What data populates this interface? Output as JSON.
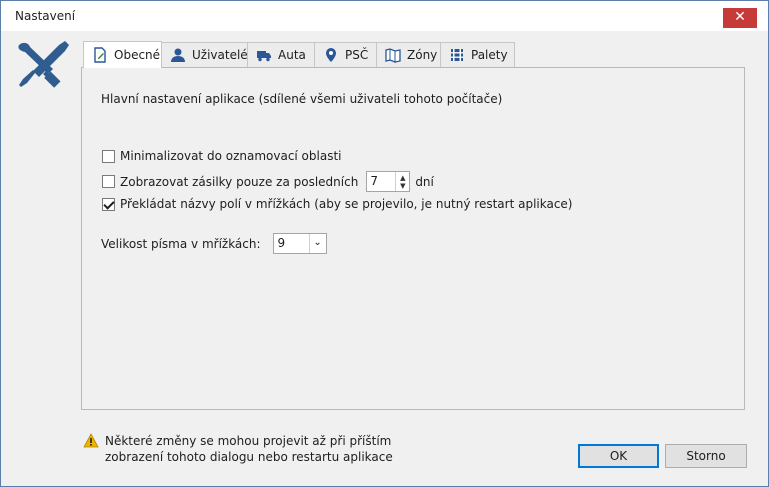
{
  "window": {
    "title": "Nastavení",
    "close_label": "✕"
  },
  "tabs": [
    {
      "label": "Obecné",
      "icon": "page-edit-icon",
      "active": true
    },
    {
      "label": "Uživatelé",
      "icon": "user-icon"
    },
    {
      "label": "Auta",
      "icon": "truck-icon"
    },
    {
      "label": "PSČ",
      "icon": "map-pin-icon"
    },
    {
      "label": "Zóny",
      "icon": "map-icon"
    },
    {
      "label": "Palety",
      "icon": "pallet-icon"
    }
  ],
  "general": {
    "description": "Hlavní nastavení aplikace (sdílené všemi uživateli tohoto počítače)",
    "options": [
      {
        "label": "Minimalizovat do oznamovací oblasti",
        "checked": false
      },
      {
        "label": "Zobrazovat zásilky pouze za posledních",
        "checked": false,
        "spin_value": "7",
        "suffix": "dní"
      },
      {
        "label": "Překládat názvy polí v mřížkách (aby se projevilo, je nutný restart aplikace)",
        "checked": true
      }
    ],
    "font_size_label": "Velikost písma v mřížkách:",
    "font_size_value": "9"
  },
  "footer": {
    "warning_line1": "Některé změny se mohou projevit až při příštím",
    "warning_line2": "zobrazení tohoto dialogu nebo restartu aplikace",
    "ok_label": "OK",
    "cancel_label": "Storno"
  },
  "colors": {
    "close": "#c73a3a",
    "accent": "#0078d7",
    "tab_icon": "#2b5797",
    "warning": "#f0b400"
  }
}
